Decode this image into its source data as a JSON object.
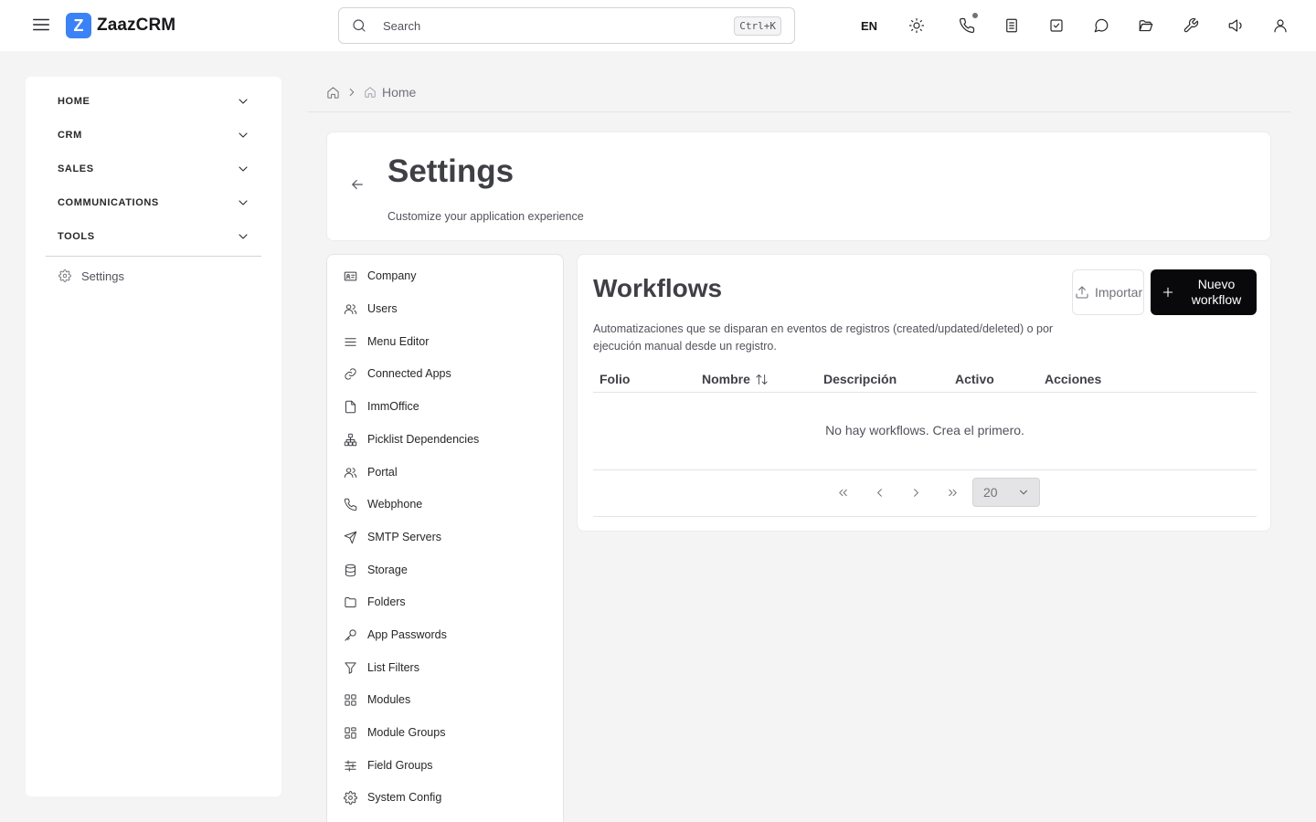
{
  "app": {
    "logo_letter": "Z",
    "name": "ZaazCRM",
    "brand_color": "#3b82f6"
  },
  "topbar": {
    "search_placeholder": "Search",
    "search_shortcut": "Ctrl+K",
    "language": "EN",
    "icons": [
      "sun-icon",
      "phone-icon",
      "notes-icon",
      "tasks-icon",
      "chat-icon",
      "folder-icon",
      "wrench-icon",
      "megaphone-icon",
      "user-icon"
    ]
  },
  "sidebar": {
    "groups": [
      {
        "label": "HOME"
      },
      {
        "label": "CRM"
      },
      {
        "label": "SALES"
      },
      {
        "label": "COMMUNICATIONS"
      },
      {
        "label": "TOOLS"
      }
    ],
    "settings_label": "Settings"
  },
  "breadcrumb": {
    "current": "Home"
  },
  "header": {
    "title": "Settings",
    "subtitle": "Customize your application experience"
  },
  "settings_menu": {
    "items": [
      {
        "label": "Company",
        "icon": "id-card-icon"
      },
      {
        "label": "Users",
        "icon": "users-icon"
      },
      {
        "label": "Menu Editor",
        "icon": "menu-lines-icon"
      },
      {
        "label": "Connected Apps",
        "icon": "link-icon"
      },
      {
        "label": "ImmOffice",
        "icon": "file-icon"
      },
      {
        "label": "Picklist Dependencies",
        "icon": "hierarchy-icon"
      },
      {
        "label": "Portal",
        "icon": "users-icon"
      },
      {
        "label": "Webphone",
        "icon": "phone-icon"
      },
      {
        "label": "SMTP Servers",
        "icon": "send-icon"
      },
      {
        "label": "Storage",
        "icon": "database-icon"
      },
      {
        "label": "Folders",
        "icon": "folder-icon"
      },
      {
        "label": "App Passwords",
        "icon": "key-icon"
      },
      {
        "label": "List Filters",
        "icon": "filter-icon"
      },
      {
        "label": "Modules",
        "icon": "grid-icon"
      },
      {
        "label": "Module Groups",
        "icon": "grid-group-icon"
      },
      {
        "label": "Field Groups",
        "icon": "sliders-icon"
      },
      {
        "label": "System Config",
        "icon": "gear-icon"
      }
    ]
  },
  "workflows": {
    "title": "Workflows",
    "description": "Automatizaciones que se disparan en eventos de registros (created/updated/deleted) o por ejecución manual desde un registro.",
    "import_label": "Importar",
    "new_label": "Nuevo workflow",
    "columns": [
      "Folio",
      "Nombre",
      "Descripción",
      "Activo",
      "Acciones"
    ],
    "empty_message": "No hay workflows. Crea el primero.",
    "page_size": "20"
  }
}
